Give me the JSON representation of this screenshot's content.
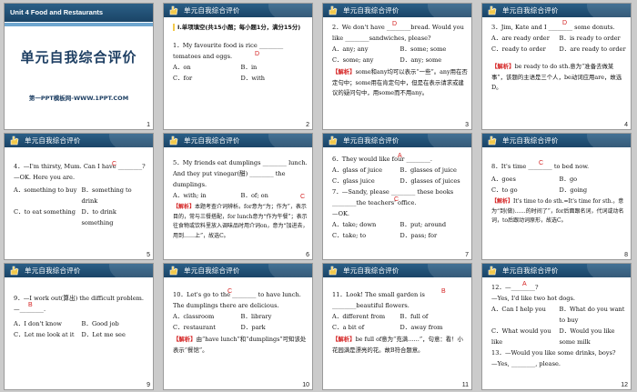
{
  "header_title": "单元自我综合评价",
  "cover": {
    "unit": "Unit 4   Food and Restaurants",
    "title": "单元自我综合评价",
    "subtitle": "第一PPT模板网-WWW.1PPT.COM",
    "num": "1"
  },
  "slides": [
    {
      "num": "2",
      "section": "Ⅰ.单项填空(共15小题；每小题1分，满分15分)",
      "q": "1．My favourite food is rice ________ tomatoes and eggs.",
      "ans": "D",
      "opts": [
        "A．on",
        "B．in",
        "C．for",
        "D．with"
      ]
    },
    {
      "num": "3",
      "q": "2．We don't have ________bread. Would you like ________sandwiches, please?",
      "ans": "D",
      "opts": [
        "A．any; any",
        "B．some; some",
        "C．some; any",
        "D．any; some"
      ],
      "exp_tag": "【解析】",
      "exp": "some和any均可以表示“一些”。any用在否定句中；some用在肯定句中，但是在表示请求或建议的疑问句中，用some而不用any。"
    },
    {
      "num": "4",
      "q": "3．Jim, Kate and I ________ some donuts.",
      "ans": "D",
      "opts": [
        "A．are ready order",
        "B．is ready to order",
        "C．ready to order",
        "D．are ready to order"
      ],
      "exp_tag": "【解析】",
      "exp": "be ready to do sth.意为“准备去做某事”，该题的主语是三个人，be动词应用are，故选D。"
    },
    {
      "num": "5",
      "q": "4．—I'm thirsty, Mum. Can I have ________?\n—OK. Here you are.",
      "ans": "C",
      "opts": [
        "A．something to buy",
        "B．something to drink",
        "C．to eat something",
        "D．to drink something"
      ]
    },
    {
      "num": "6",
      "q": "5．My friends eat dumplings ________ lunch. And they put vinegar(醋) ________ the dumplings.",
      "ans": "C",
      "opts": [
        "A．with; in",
        "B．of; on",
        "C．for; on",
        "D．for; in"
      ],
      "exp_tag": "【解析】",
      "exp": "本题考查介词辨析。for意为“为；作为”，表示目的，常与三餐搭配，for lunch意为“作为午餐”；表示往食物或饮料里放入调味品时用介词on，意为“加进去，用到……上”，故选C。"
    },
    {
      "num": "7",
      "q": "6．They would like four ________.",
      "ans": "A",
      "opts": [
        "A．glass of juice",
        "B．glasses of juice",
        "C．glass juice",
        "D．glasses of juices"
      ],
      "q2": "7．—Sandy, please ________ these books ________the teachers' office.\n—OK.",
      "ans2": "C",
      "opts2": [
        "A．take; down",
        "B．put; around",
        "C．take; to",
        "D．pass; for"
      ]
    },
    {
      "num": "8",
      "q": "8．It's time ________ to bed now.",
      "ans": "C",
      "opts": [
        "A．goes",
        "B．go",
        "C．to go",
        "D．going"
      ],
      "exp_tag": "【解析】",
      "exp": "It's time to do sth.=It's time for sth.，意为“到(做)……的时间了”，for后面跟名词，代词或动名词，to后跟动词原形，故选C。"
    },
    {
      "num": "9",
      "q": "9．—I work out(算出) the difficult problem.\n—________.",
      "ans": "B",
      "opts": [
        "A．I don't know",
        "B．Good job",
        "C．Let me look at it",
        "D．Let me see"
      ]
    },
    {
      "num": "10",
      "q": "10．Let's go to the ________ to have lunch. The dumplings there are delicious.",
      "ans": "C",
      "opts": [
        "A．classroom",
        "B．library",
        "C．restaurant",
        "D．park"
      ],
      "exp_tag": "【解析】",
      "exp": "由“have lunch”和“dumplings”可知该处表示“餐馆”。"
    },
    {
      "num": "11",
      "q": "11．Look! The small garden is ________beautiful flowers.",
      "ans": "B",
      "opts": [
        "A．different from",
        "B．full of",
        "C．a bit of",
        "D．away from"
      ],
      "exp_tag": "【解析】",
      "exp": "be full of意为“充满……”，句意：看！小花园满是漂亮的花。故B符合题意。"
    },
    {
      "num": "12",
      "q": "12．—________?\n—Yes, I'd like two hot dogs.",
      "ans": "A",
      "opts": [
        "A．Can I help you",
        "B．What do you want to buy",
        "C．What would you like",
        "D．Would you like some milk"
      ],
      "q2": "13．—Would you like some drinks, boys?\n—Yes, ________, please."
    }
  ]
}
